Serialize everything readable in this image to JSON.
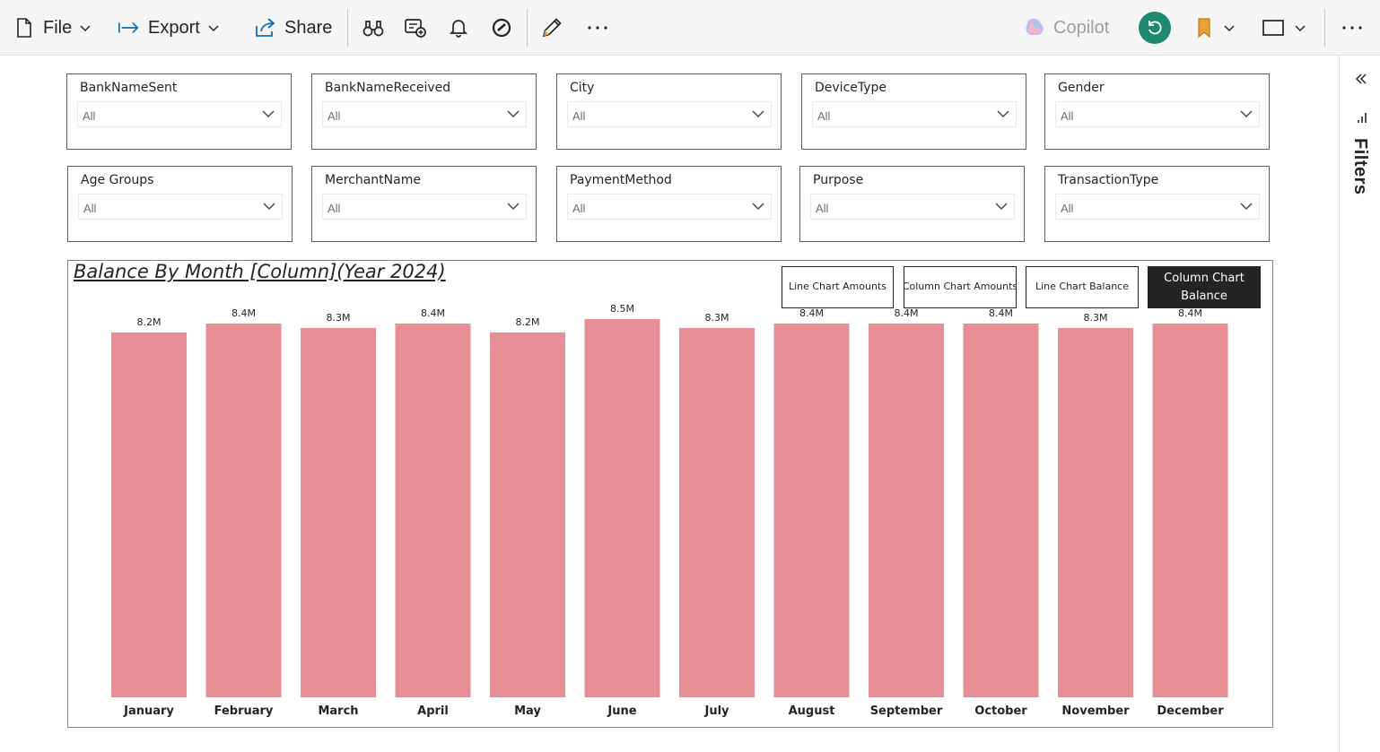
{
  "toolbar": {
    "file_label": "File",
    "export_label": "Export",
    "share_label": "Share",
    "copilot_label": "Copilot",
    "icons": [
      "file-icon",
      "export-icon",
      "share-icon",
      "binoculars-icon",
      "add-comment-icon",
      "bell-icon",
      "gauge-icon",
      "pencil-icon",
      "more-icon",
      "copilot-icon",
      "reset-icon",
      "bookmark-icon",
      "view-icon",
      "more-icon"
    ]
  },
  "filters_pane": {
    "label": "Filters"
  },
  "slicers": [
    {
      "title": "BankNameSent",
      "value": "All"
    },
    {
      "title": "BankNameReceived",
      "value": "All"
    },
    {
      "title": "City",
      "value": "All"
    },
    {
      "title": "DeviceType",
      "value": "All"
    },
    {
      "title": "Gender",
      "value": "All"
    },
    {
      "title": "Age Groups",
      "value": "All"
    },
    {
      "title": "MerchantName",
      "value": "All"
    },
    {
      "title": "PaymentMethod",
      "value": "All"
    },
    {
      "title": "Purpose",
      "value": "All"
    },
    {
      "title": "TransactionType",
      "value": "All"
    }
  ],
  "visual": {
    "title": "Balance By Month [Column](Year 2024)",
    "buttons": [
      {
        "label": "Line Chart Amounts",
        "active": false
      },
      {
        "label": "Column Chart Amounts",
        "active": false
      },
      {
        "label": "Line Chart Balance",
        "active": false
      },
      {
        "label": "Column Chart Balance",
        "active": true
      }
    ]
  },
  "colors": {
    "bar": "#e68f96",
    "active_button": "#252423",
    "copilot_green": "#1d8a6e",
    "bookmark": "#e8a23a"
  },
  "chart_data": {
    "type": "bar",
    "title": "Balance By Month [Column](Year 2024)",
    "categories": [
      "January",
      "February",
      "March",
      "April",
      "May",
      "June",
      "July",
      "August",
      "September",
      "October",
      "November",
      "December"
    ],
    "values": [
      8.2,
      8.4,
      8.3,
      8.4,
      8.2,
      8.5,
      8.3,
      8.4,
      8.4,
      8.4,
      8.3,
      8.4
    ],
    "data_labels": [
      "8.2M",
      "8.4M",
      "8.3M",
      "8.4M",
      "8.2M",
      "8.5M",
      "8.3M",
      "8.4M",
      "8.4M",
      "8.4M",
      "8.3M",
      "8.4M"
    ],
    "unit": "M",
    "ylim": [
      0,
      8.5
    ],
    "grid": false,
    "legend": "none"
  }
}
